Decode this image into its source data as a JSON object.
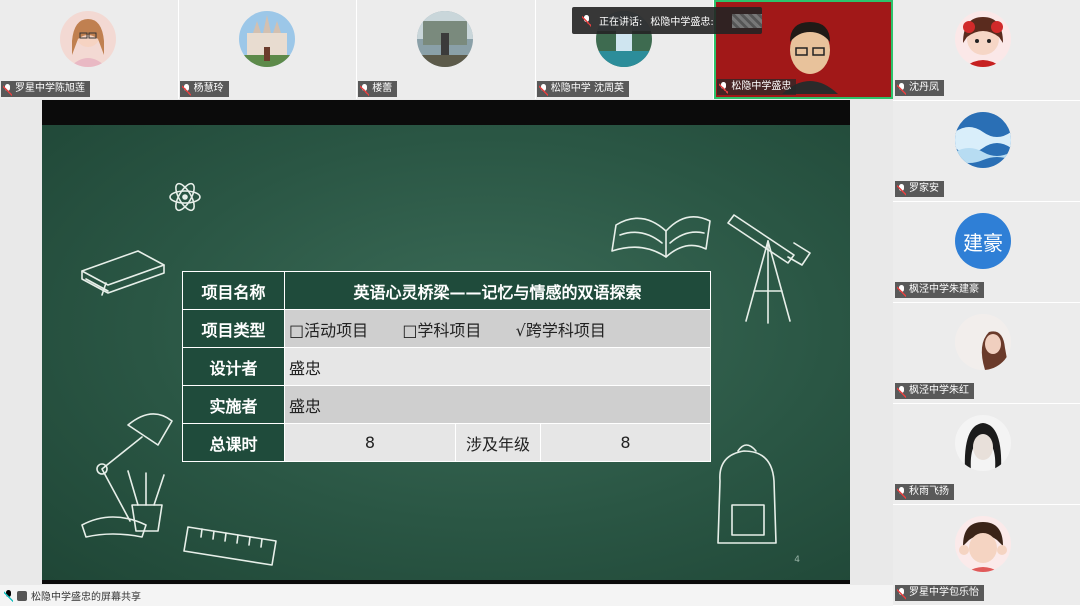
{
  "speaking": {
    "label": "正在讲话:",
    "name": "松隐中学盛忠:"
  },
  "top_participants": [
    {
      "name": "罗星中学陈旭莲"
    },
    {
      "name": "杨慧玲"
    },
    {
      "name": "楼蕾"
    },
    {
      "name": "松隐中学 沈周英"
    },
    {
      "name": "松隐中学盛忠"
    }
  ],
  "right_participants": [
    {
      "name": "沈丹凤"
    },
    {
      "name": "罗家安"
    },
    {
      "name": "枫泾中学朱建豪",
      "avatar_text": "建豪"
    },
    {
      "name": "枫泾中学朱红"
    },
    {
      "name": "秋雨飞扬"
    },
    {
      "name": "罗星中学包乐怡"
    }
  ],
  "slide": {
    "page_number": "4",
    "rows": {
      "name_label": "项目名称",
      "name_value": "英语心灵桥梁——记忆与情感的双语探索",
      "type_label": "项目类型",
      "type_opt1": "□活动项目",
      "type_opt2": "□学科项目",
      "type_opt3": "√跨学科项目",
      "designer_label": "设计者",
      "designer_value": "盛忠",
      "implementer_label": "实施者",
      "implementer_value": "盛忠",
      "hours_label": "总课时",
      "hours_value": "8",
      "grade_label": "涉及年级",
      "grade_value": "8"
    }
  },
  "bottom_bar": {
    "text": "松隐中学盛忠的屏幕共享"
  },
  "colors": {
    "board": "#2a5644",
    "active_border": "#2dc26b",
    "avatar_blue": "#2f7fd6"
  }
}
